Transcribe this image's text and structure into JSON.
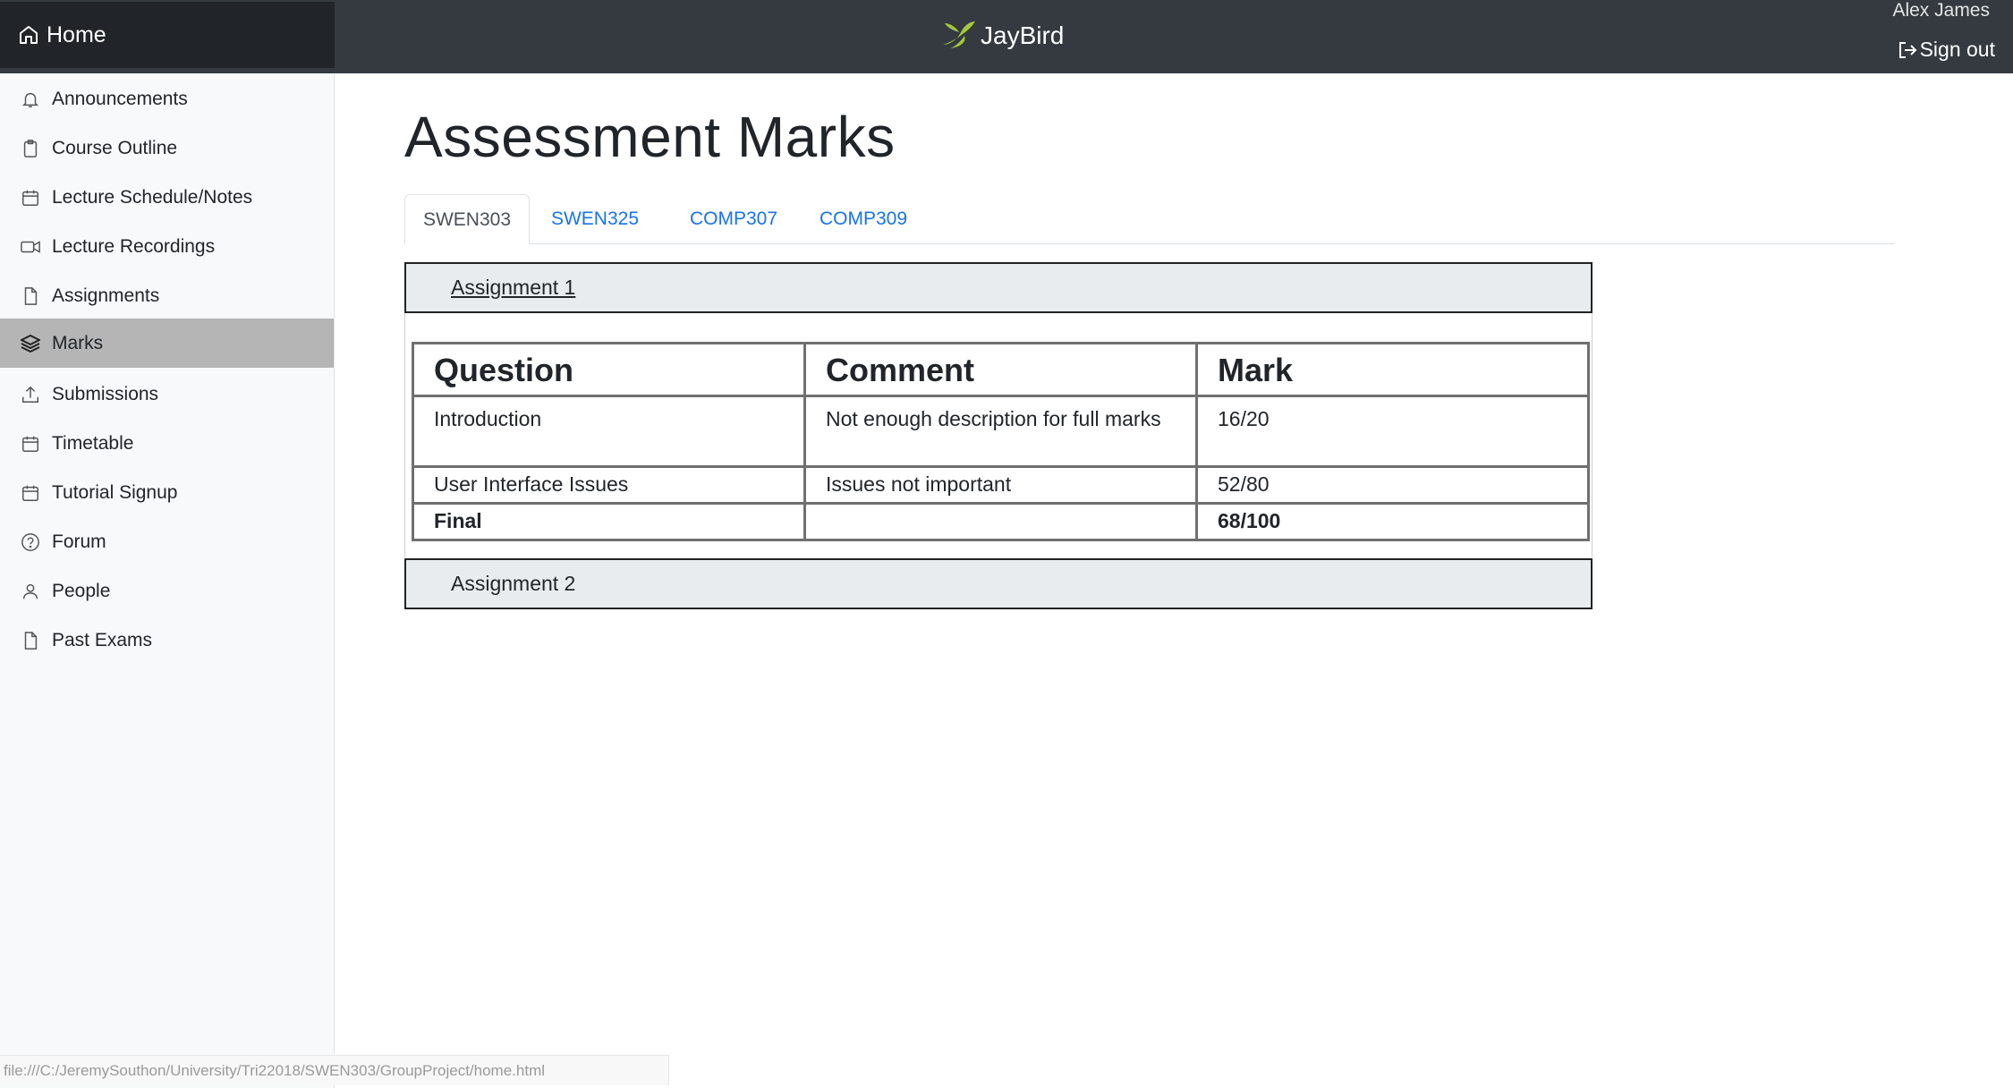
{
  "header": {
    "home_label": "Home",
    "brand": "JayBird",
    "user_name": "Alex James",
    "signout_label": "Sign out"
  },
  "sidebar": {
    "items": [
      {
        "label": "Announcements",
        "icon": "bell-icon"
      },
      {
        "label": "Course Outline",
        "icon": "clipboard-icon"
      },
      {
        "label": "Lecture Schedule/Notes",
        "icon": "calendar-icon"
      },
      {
        "label": "Lecture Recordings",
        "icon": "video-icon"
      },
      {
        "label": "Assignments",
        "icon": "file-icon"
      },
      {
        "label": "Marks",
        "icon": "layers-icon",
        "active": true
      },
      {
        "label": "Submissions",
        "icon": "upload-icon"
      },
      {
        "label": "Timetable",
        "icon": "calendar-icon"
      },
      {
        "label": "Tutorial Signup",
        "icon": "calendar-icon"
      },
      {
        "label": "Forum",
        "icon": "help-circle-icon"
      },
      {
        "label": "People",
        "icon": "user-icon"
      },
      {
        "label": "Past Exams",
        "icon": "file-icon"
      }
    ]
  },
  "main": {
    "title": "Assessment Marks",
    "tabs": [
      {
        "label": "SWEN303",
        "active": true
      },
      {
        "label": "SWEN325"
      },
      {
        "label": "COMP307"
      },
      {
        "label": "COMP309"
      }
    ],
    "assignments": [
      {
        "title": "Assignment 1",
        "expanded": true,
        "columns": [
          "Question",
          "Comment",
          "Mark"
        ],
        "rows": [
          [
            "Introduction",
            "Not enough description for full marks",
            "16/20"
          ],
          [
            "User Interface Issues",
            "Issues not important",
            "52/80"
          ]
        ],
        "final": [
          "Final",
          "",
          "68/100"
        ]
      },
      {
        "title": "Assignment 2",
        "expanded": false
      }
    ]
  },
  "statusbar": {
    "url": "file:///C:/JeremySouthon/University/Tri22018/SWEN303/GroupProject/home.html"
  },
  "colors": {
    "navbar": "#343a40",
    "home_block": "#212428",
    "sidebar_bg": "#f8f9fa",
    "sidebar_active": "#b5b5b5",
    "link": "#1a73e8",
    "brand_leaf": "#a4c639"
  }
}
